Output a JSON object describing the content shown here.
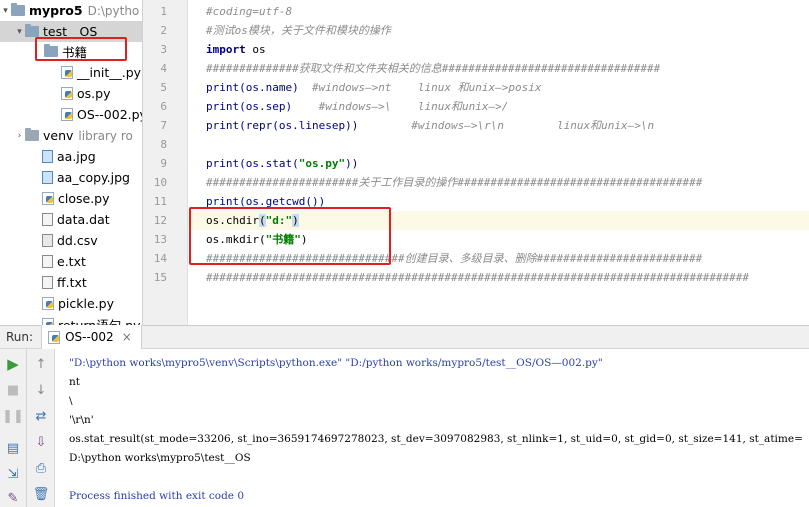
{
  "project_tree": {
    "root": {
      "name": "mypro5",
      "path": "D:\\pytho"
    },
    "folder": {
      "name": "test__OS"
    },
    "subfolder": {
      "name": "书籍"
    },
    "files_in_folder": [
      "__init__.py",
      "os.py",
      "OS--002.py"
    ],
    "venv": {
      "name": "venv",
      "hint": "library ro"
    },
    "root_files": [
      "aa.jpg",
      "aa_copy.jpg",
      "close.py",
      "data.dat",
      "dd.csv",
      "e.txt",
      "ff.txt",
      "pickle.py",
      "return语句.py"
    ]
  },
  "editor": {
    "line_numbers": [
      "1",
      "2",
      "3",
      "4",
      "5",
      "6",
      "7",
      "8",
      "9",
      "10",
      "11",
      "12",
      "13",
      "14",
      "15"
    ],
    "current_line": "12",
    "code": {
      "l1": "#coding=utf-8",
      "l2": "#测试os模块，关于文件和模块的操作",
      "l3_kw": "import",
      "l3_rest": " os",
      "l4": "##############获取文件和文件夹相关的信息#################################",
      "l5_code": "print(os.name)",
      "l5_com": "  #windows—>nt    linux 和unix—>posix",
      "l6_code": "print(os.sep)",
      "l6_com": "    #windows—>\\    linux和unix—>/",
      "l7_code": "print(repr(os.linesep))",
      "l7_com": "        #windows—>\\r\\n        linux和unix—>\\n",
      "l9_a": "print(os.stat(",
      "l9_str": "\"os.py\"",
      "l9_b": "))",
      "l10": "#######################关于工作目录的操作#####################################",
      "l11": "print(os.getcwd())",
      "l12_a": "os.chdir",
      "l12_p1": "(",
      "l12_str": "\"d:\"",
      "l12_p2": ")",
      "l13_a": "os.mkdir(",
      "l13_str": "\"书籍\"",
      "l13_b": ")",
      "l14": "##############################创建目录、多级目录、删除#########################",
      "l15": "##################################################################################"
    }
  },
  "run_panel": {
    "label": "Run:",
    "tab": "OS--002",
    "output": [
      "\"D:\\python works\\mypro5\\venv\\Scripts\\python.exe\" \"D:/python works/mypro5/test__OS/OS—002.py\"",
      "nt",
      "\\",
      "'\\r\\n'",
      "os.stat_result(st_mode=33206, st_ino=3659174697278023, st_dev=3097082983, st_nlink=1, st_uid=0, st_gid=0, st_size=141, st_atime=",
      "D:\\python works\\mypro5\\test__OS",
      "",
      "Process finished with exit code 0"
    ]
  },
  "colors": {
    "highlight_box": "#e02020",
    "keyword": "#000080",
    "string": "#008000",
    "comment": "#8c8c8c",
    "console_link": "#2a3ea8"
  }
}
